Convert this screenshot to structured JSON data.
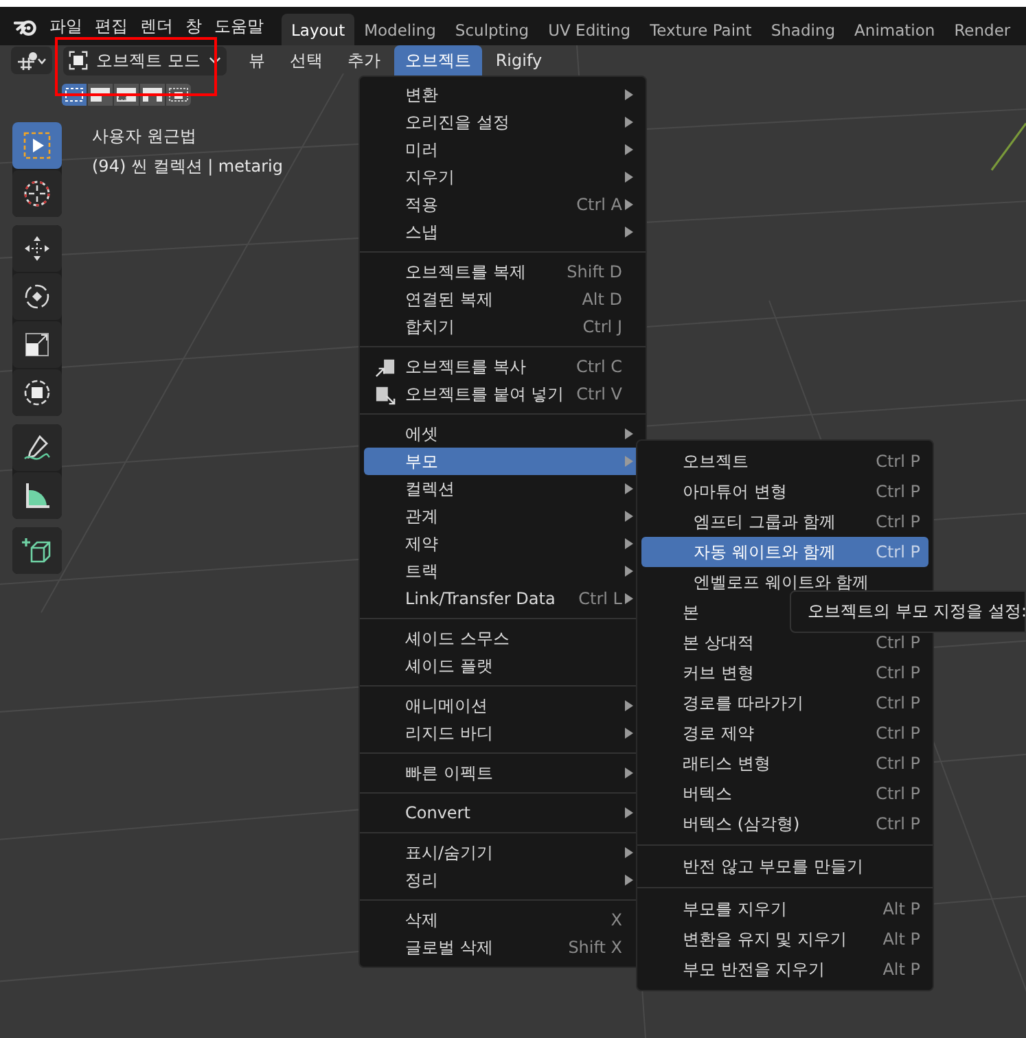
{
  "topbar": {
    "menus": [
      "파일",
      "편집",
      "렌더",
      "창",
      "도움말"
    ],
    "workspaces": [
      {
        "label": "Layout",
        "selected": true
      },
      {
        "label": "Modeling",
        "selected": false
      },
      {
        "label": "Sculpting",
        "selected": false
      },
      {
        "label": "UV Editing",
        "selected": false
      },
      {
        "label": "Texture Paint",
        "selected": false
      },
      {
        "label": "Shading",
        "selected": false
      },
      {
        "label": "Animation",
        "selected": false
      },
      {
        "label": "Render",
        "selected": false
      }
    ]
  },
  "header": {
    "mode": "오브젝트 모드",
    "menus": [
      {
        "label": "뷰",
        "selected": false
      },
      {
        "label": "선택",
        "selected": false
      },
      {
        "label": "추가",
        "selected": false
      },
      {
        "label": "오브젝트",
        "selected": true
      },
      {
        "label": "Rigify",
        "selected": false
      }
    ]
  },
  "selection_modes": [
    {
      "kind": "set",
      "selected": true
    },
    {
      "kind": "extend",
      "selected": false
    },
    {
      "kind": "subtract",
      "selected": false
    },
    {
      "kind": "invert",
      "selected": false
    },
    {
      "kind": "intersect",
      "selected": false
    }
  ],
  "toolbar": [
    [
      {
        "kind": "select",
        "selected": true
      },
      {
        "kind": "cursor",
        "selected": false
      }
    ],
    [
      {
        "kind": "move",
        "selected": false
      },
      {
        "kind": "rotate",
        "selected": false
      },
      {
        "kind": "scale",
        "selected": false
      },
      {
        "kind": "transform",
        "selected": false
      }
    ],
    [
      {
        "kind": "annotate",
        "selected": false
      },
      {
        "kind": "measure",
        "selected": false
      }
    ],
    [
      {
        "kind": "add-cube",
        "selected": false
      }
    ]
  ],
  "viewport": {
    "view_name": "사용자 원근법",
    "info": "(94) 씬 컬렉션 | metarig"
  },
  "object_menu": [
    [
      {
        "label": "변환",
        "submenu": true,
        "selected": false
      },
      {
        "label": "오리진을 설정",
        "submenu": true,
        "selected": false
      },
      {
        "label": "미러",
        "submenu": true,
        "selected": false
      },
      {
        "label": "지우기",
        "submenu": true,
        "selected": false
      },
      {
        "label": "적용",
        "shortcut": "Ctrl A",
        "submenu": true,
        "selected": false
      },
      {
        "label": "스냅",
        "submenu": true,
        "selected": false
      }
    ],
    [
      {
        "label": "오브젝트를 복제",
        "shortcut": "Shift D",
        "submenu": false,
        "selected": false
      },
      {
        "label": "연결된 복제",
        "shortcut": "Alt D",
        "submenu": false,
        "selected": false
      },
      {
        "label": "합치기",
        "shortcut": "Ctrl J",
        "submenu": false,
        "selected": false
      }
    ],
    [
      {
        "label": "오브젝트를 복사",
        "shortcut": "Ctrl C",
        "submenu": false,
        "selected": false
      },
      {
        "label": "오브젝트를 붙여 넣기",
        "shortcut": "Ctrl V",
        "submenu": false,
        "selected": false
      }
    ],
    [
      {
        "label": "에셋",
        "submenu": true,
        "selected": false
      },
      {
        "label": "부모",
        "submenu": true,
        "selected": true
      },
      {
        "label": "컬렉션",
        "submenu": true,
        "selected": false
      },
      {
        "label": "관계",
        "submenu": true,
        "selected": false
      },
      {
        "label": "제약",
        "submenu": true,
        "selected": false
      },
      {
        "label": "트랙",
        "submenu": true,
        "selected": false
      },
      {
        "label": "Link/Transfer Data",
        "shortcut": "Ctrl L",
        "submenu": true,
        "selected": false
      }
    ],
    [
      {
        "label": "셰이드 스무스",
        "submenu": false,
        "selected": false
      },
      {
        "label": "셰이드 플랫",
        "submenu": false,
        "selected": false
      }
    ],
    [
      {
        "label": "애니메이션",
        "submenu": true,
        "selected": false
      },
      {
        "label": "리지드 바디",
        "submenu": true,
        "selected": false
      }
    ],
    [
      {
        "label": "빠른 이펙트",
        "submenu": true,
        "selected": false
      }
    ],
    [
      {
        "label": "Convert",
        "submenu": true,
        "selected": false
      }
    ],
    [
      {
        "label": "표시/숨기기",
        "submenu": true,
        "selected": false
      },
      {
        "label": "정리",
        "submenu": true,
        "selected": false
      }
    ],
    [
      {
        "label": "삭제",
        "shortcut": "X",
        "submenu": false,
        "selected": false
      },
      {
        "label": "글로벌 삭제",
        "shortcut": "Shift X",
        "submenu": false,
        "selected": false
      }
    ]
  ],
  "parent_menu": [
    [
      {
        "label": "오브젝트",
        "shortcut": "Ctrl P",
        "selected": false
      },
      {
        "label": "아마튜어 변형",
        "shortcut": "Ctrl P",
        "selected": false,
        "children": [
          {
            "label": "엠프티 그룹과 함께",
            "shortcut": "Ctrl P",
            "selected": false
          },
          {
            "label": "자동 웨이트와 함께",
            "shortcut": "Ctrl P",
            "selected": true
          },
          {
            "label": "엔벨로프 웨이트와 함께",
            "selected": false
          }
        ]
      },
      {
        "label": "본",
        "selected": false
      },
      {
        "label": "본 상대적",
        "shortcut": "Ctrl P",
        "selected": false
      },
      {
        "label": "커브 변형",
        "shortcut": "Ctrl P",
        "selected": false
      },
      {
        "label": "경로를 따라가기",
        "shortcut": "Ctrl P",
        "selected": false
      },
      {
        "label": "경로 제약",
        "shortcut": "Ctrl P",
        "selected": false
      },
      {
        "label": "래티스 변형",
        "shortcut": "Ctrl P",
        "selected": false
      },
      {
        "label": "버텍스",
        "shortcut": "Ctrl P",
        "selected": false
      },
      {
        "label": "버텍스 (삼각형)",
        "shortcut": "Ctrl P",
        "selected": false
      }
    ],
    [
      {
        "label": "반전 않고 부모를 만들기",
        "selected": false
      }
    ],
    [
      {
        "label": "부모를 지우기",
        "shortcut": "Alt P",
        "selected": false
      },
      {
        "label": "변환을 유지 및 지우기",
        "shortcut": "Alt P",
        "selected": false
      },
      {
        "label": "부모 반전을 지우기",
        "shortcut": "Alt P",
        "selected": false
      }
    ]
  ],
  "tooltip": "오브젝트의 부모 지정을 설정:"
}
